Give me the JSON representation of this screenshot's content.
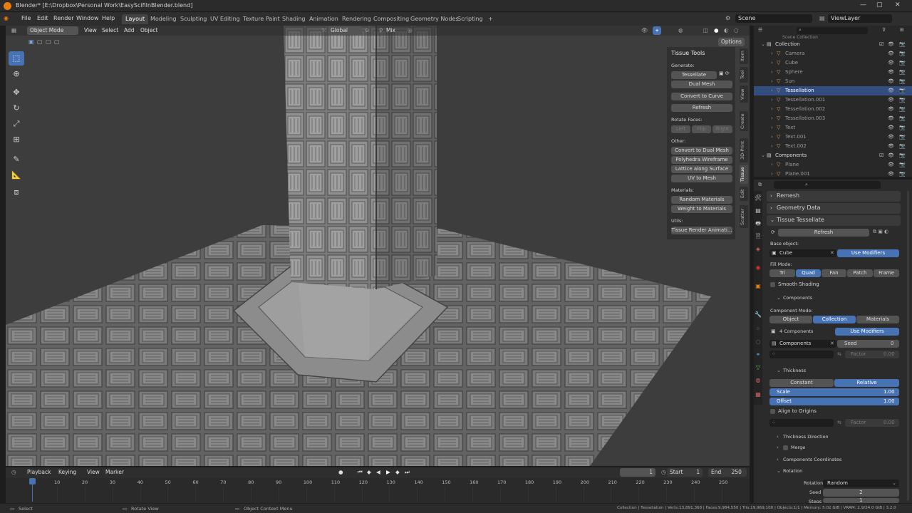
{
  "window": {
    "title": "Blender* [E:\\Dropbox\\Personal Work\\EasyScifiInBlender.blend]",
    "controls": [
      "—",
      "▢",
      "✕"
    ]
  },
  "menu": {
    "items": [
      "File",
      "Edit",
      "Render",
      "Window",
      "Help"
    ],
    "workspaces": [
      "Layout",
      "Modeling",
      "Sculpting",
      "UV Editing",
      "Texture Paint",
      "Shading",
      "Animation",
      "Rendering",
      "Compositing",
      "Geometry Nodes",
      "Scripting"
    ],
    "active_workspace": "Layout",
    "add_tab": "+",
    "scene": "Scene",
    "view_layer": "ViewLayer"
  },
  "viewport_header": {
    "mode": "Object Mode",
    "menus": [
      "View",
      "Select",
      "Add",
      "Object"
    ],
    "transform": "Global",
    "pivot": "Mix",
    "options": "Options"
  },
  "n_panel": {
    "title": "Tissue Tools",
    "generate_label": "Generate:",
    "tessellate": "Tessellate",
    "dual_mesh": "Dual Mesh",
    "convert_curve": "Convert to Curve",
    "refresh": "Refresh",
    "rotate_faces_label": "Rotate Faces:",
    "rotate": [
      "Left",
      "Flip",
      "Right"
    ],
    "other_label": "Other:",
    "other": [
      "Convert to Dual Mesh",
      "Polyhedra Wireframe",
      "Lattice along Surface",
      "UV to Mesh"
    ],
    "materials_label": "Materials:",
    "materials": [
      "Random Materials",
      "Weight to Materials"
    ],
    "utils_label": "Utils:",
    "utils": [
      "Tissue Render Animati..."
    ],
    "tabs": [
      "Item",
      "Tool",
      "View",
      "Create",
      "3D-Print",
      "Tissue",
      "Edit",
      "Scatter"
    ]
  },
  "outliner": {
    "partial_top": "Scene Collection",
    "rows": [
      {
        "name": "Collection",
        "depth": 1,
        "kind": "collection"
      },
      {
        "name": "Camera",
        "depth": 2,
        "kind": "object"
      },
      {
        "name": "Cube",
        "depth": 2,
        "kind": "object"
      },
      {
        "name": "Sphere",
        "depth": 2,
        "kind": "object"
      },
      {
        "name": "Sun",
        "depth": 2,
        "kind": "object"
      },
      {
        "name": "Tessellation",
        "depth": 2,
        "kind": "object",
        "selected": true
      },
      {
        "name": "Tessellation.001",
        "depth": 2,
        "kind": "object"
      },
      {
        "name": "Tessellation.002",
        "depth": 2,
        "kind": "object"
      },
      {
        "name": "Tessellation.003",
        "depth": 2,
        "kind": "object"
      },
      {
        "name": "Text",
        "depth": 2,
        "kind": "object"
      },
      {
        "name": "Text.001",
        "depth": 2,
        "kind": "object"
      },
      {
        "name": "Text.002",
        "depth": 2,
        "kind": "object"
      },
      {
        "name": "Components",
        "depth": 1,
        "kind": "collection"
      },
      {
        "name": "Plane",
        "depth": 2,
        "kind": "object"
      },
      {
        "name": "Plane.001",
        "depth": 2,
        "kind": "object"
      }
    ]
  },
  "properties": {
    "remesh": "Remesh",
    "geometry_data": "Geometry Data",
    "tissue_tessellate": "Tissue Tessellate",
    "refresh": "Refresh",
    "base_object_label": "Base object:",
    "base_object": "Cube",
    "use_modifiers": "Use Modifiers",
    "fill_mode_label": "Fill Mode:",
    "fill_modes": [
      "Tri",
      "Quad",
      "Fan",
      "Patch",
      "Frame"
    ],
    "fill_mode_active": "Quad",
    "smooth_shading": "Smooth Shading",
    "components_header": "Components",
    "component_mode_label": "Component Mode:",
    "component_modes": [
      "Object",
      "Collection",
      "Materials"
    ],
    "component_mode_active": "Collection",
    "components_count": "4 Components",
    "use_modifiers_2": "Use Modifiers",
    "components_collection": "Components",
    "seed_label": "Seed",
    "seed_value": "0",
    "factor_label": "Factor",
    "factor_value": "0.00",
    "thickness_header": "Thickness",
    "thickness_modes": [
      "Constant",
      "Relative"
    ],
    "thickness_active": "Relative",
    "scale_label": "Scale",
    "scale_value": "1.00",
    "offset_label": "Offset",
    "offset_value": "1.00",
    "align_origins": "Align to Origins",
    "factor2_label": "Factor",
    "factor2_value": "0.00",
    "thickness_direction": "Thickness Direction",
    "merge": "Merge",
    "components_coordinates": "Components Coordinates",
    "rotation_header": "Rotation",
    "rotation_label": "Rotation",
    "rotation_value": "Random",
    "seed2_label": "Seed",
    "seed2_value": "2",
    "steps_label": "Steps",
    "steps_value": "1"
  },
  "timeline": {
    "menus": [
      "Playback",
      "Keying",
      "View",
      "Marker"
    ],
    "current_frame": "1",
    "start_label": "Start",
    "start": "1",
    "end_label": "End",
    "end": "250",
    "ticks": [
      "1",
      "10",
      "20",
      "30",
      "40",
      "50",
      "60",
      "70",
      "80",
      "90",
      "100",
      "110",
      "120",
      "130",
      "140",
      "150",
      "160",
      "170",
      "180",
      "190",
      "200",
      "210",
      "220",
      "230",
      "240",
      "250"
    ]
  },
  "status": {
    "select": "Select",
    "rotate_view": "Rotate View",
    "context_menu": "Object Context Menu",
    "stats": "Collection | Tessellation | Verts:13,891,368 | Faces:9,984,550 | Tris:19,969,100 | Objects:1/1 | Memory: 5.02 GiB | VRAM: 2.9/24.0 GiB | 3.2.0"
  },
  "colors": {
    "accent": "#4772b3",
    "logo": "#e87d0d",
    "selected_row": "#334d80"
  }
}
